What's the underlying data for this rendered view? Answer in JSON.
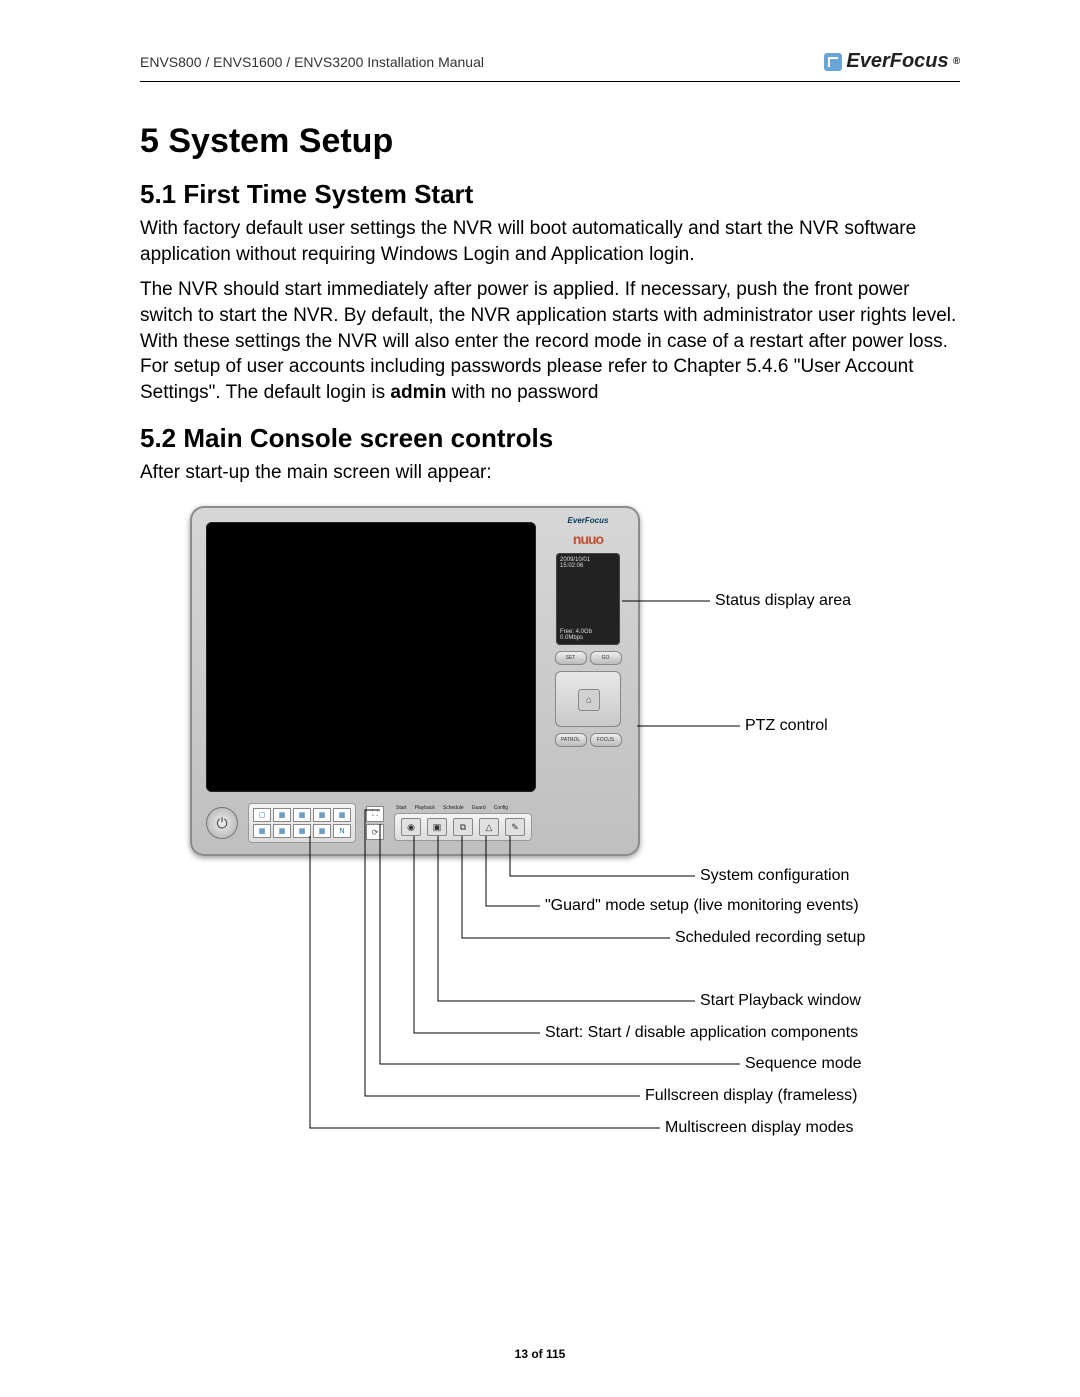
{
  "header": {
    "doc_title": "ENVS800 / ENVS1600 / ENVS3200 Installation Manual",
    "brand": "EverFocus",
    "brand_reg": "®"
  },
  "h1": "5  System Setup",
  "s51": {
    "title": "5.1   First Time System Start",
    "p1": "With factory default user settings the NVR will boot automatically and start the NVR software application without requiring Windows Login and Application login.",
    "p2_a": "The NVR should start immediately after power is applied. If necessary, push the front power switch to start the NVR.  By default, the NVR application starts with administrator user rights level. With these settings the NVR will also enter the record mode in case of a restart after power loss.  For setup of user accounts including passwords please refer to Chapter 5.4.6 \"User Account Settings\". The default login is ",
    "p2_bold": "admin",
    "p2_b": " with no password"
  },
  "s52": {
    "title": "5.2   Main Console screen controls",
    "p1": "After start-up the main screen will appear:"
  },
  "console": {
    "brand_small": "EverFocus",
    "powered": "nuuo",
    "status": {
      "date": "2009/10/01",
      "time": "15:02:06",
      "free": "Free: 4.0Gb",
      "rate": "0.0Mbps"
    },
    "btn_set": "SET",
    "btn_go": "GO",
    "btn_patrol": "PATROL",
    "btn_focus": "FOCUS",
    "menu": {
      "start": "Start",
      "playback": "Playback",
      "schedule": "Schedule",
      "guard": "Guard",
      "config": "Config"
    }
  },
  "callouts": {
    "status": "Status display area",
    "ptz": "PTZ control",
    "config": "System configuration",
    "guard": "\"Guard\" mode setup (live monitoring events)",
    "schedule": "Scheduled recording setup",
    "playback": "Start Playback window",
    "start": "Start: Start / disable application components",
    "sequence": "Sequence mode",
    "fullscreen": "Fullscreen display (frameless)",
    "multiscreen": "Multiscreen display modes"
  },
  "pagenum": "13 of 115"
}
